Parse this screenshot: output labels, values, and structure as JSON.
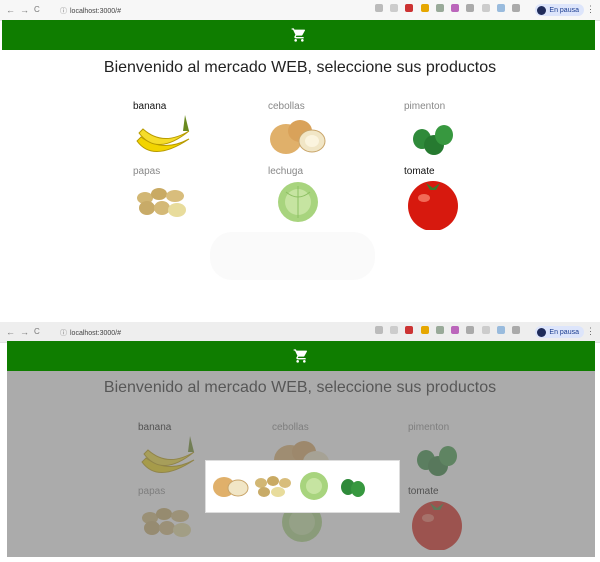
{
  "browser": {
    "url": "localhost:3000/#",
    "back": "←",
    "forward": "→",
    "reload": "C",
    "profile_status": "En pausa",
    "menu": "⋮"
  },
  "header": {
    "brand_color": "#0f7d00",
    "cart_icon": "cart-icon"
  },
  "page": {
    "title": "Bienvenido al mercado WEB, seleccione sus productos"
  },
  "products": [
    {
      "label": "banana",
      "icon": "banana"
    },
    {
      "label": "cebollas",
      "icon": "onion"
    },
    {
      "label": "pimenton",
      "icon": "pepper"
    },
    {
      "label": "papas",
      "icon": "potato"
    },
    {
      "label": "lechuga",
      "icon": "lettuce"
    },
    {
      "label": "tomate",
      "icon": "tomato"
    }
  ],
  "modal": {
    "items": [
      "onion",
      "potato",
      "lettuce",
      "pepper"
    ]
  },
  "colors": {
    "overlay": "#787878",
    "banana": "#f2d400",
    "onion": "#e0b06a",
    "pepper": "#2f8a3a",
    "potato": "#d2b774",
    "lettuce": "#a8d47e",
    "tomato": "#d7190e"
  }
}
